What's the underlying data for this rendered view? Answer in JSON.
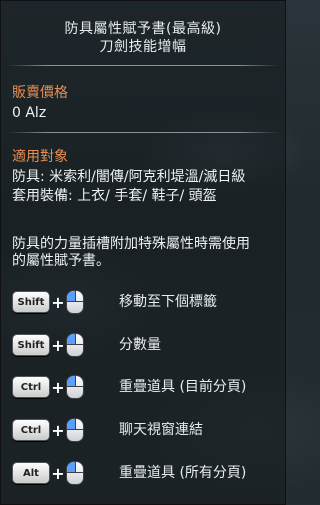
{
  "title": {
    "line1": "防具屬性賦予書(最高級)",
    "line2": "刀劍技能增幅"
  },
  "price": {
    "label": "販賣價格",
    "value": "0 Alz"
  },
  "applicable": {
    "label": "適用對象",
    "line1": "防具: 米索利/闇傳/阿克利堤溫/滅日級",
    "line2": "套用裝備: 上衣/ 手套/ 鞋子/ 頭盔"
  },
  "description": {
    "line1": "防具的力量插槽附加特殊屬性時需使用",
    "line2": "的屬性賦予書。"
  },
  "shortcuts": [
    {
      "key": "Shift",
      "action": "移動至下個標籤"
    },
    {
      "key": "Shift",
      "action": "分數量"
    },
    {
      "key": "Ctrl",
      "action": "重疊道具 (目前分頁)"
    },
    {
      "key": "Ctrl",
      "action": "聊天視窗連結"
    },
    {
      "key": "Alt",
      "action": "重疊道具 (所有分頁)"
    }
  ],
  "icons": {
    "plus": "+",
    "mouse": "left-mouse-button-icon"
  }
}
